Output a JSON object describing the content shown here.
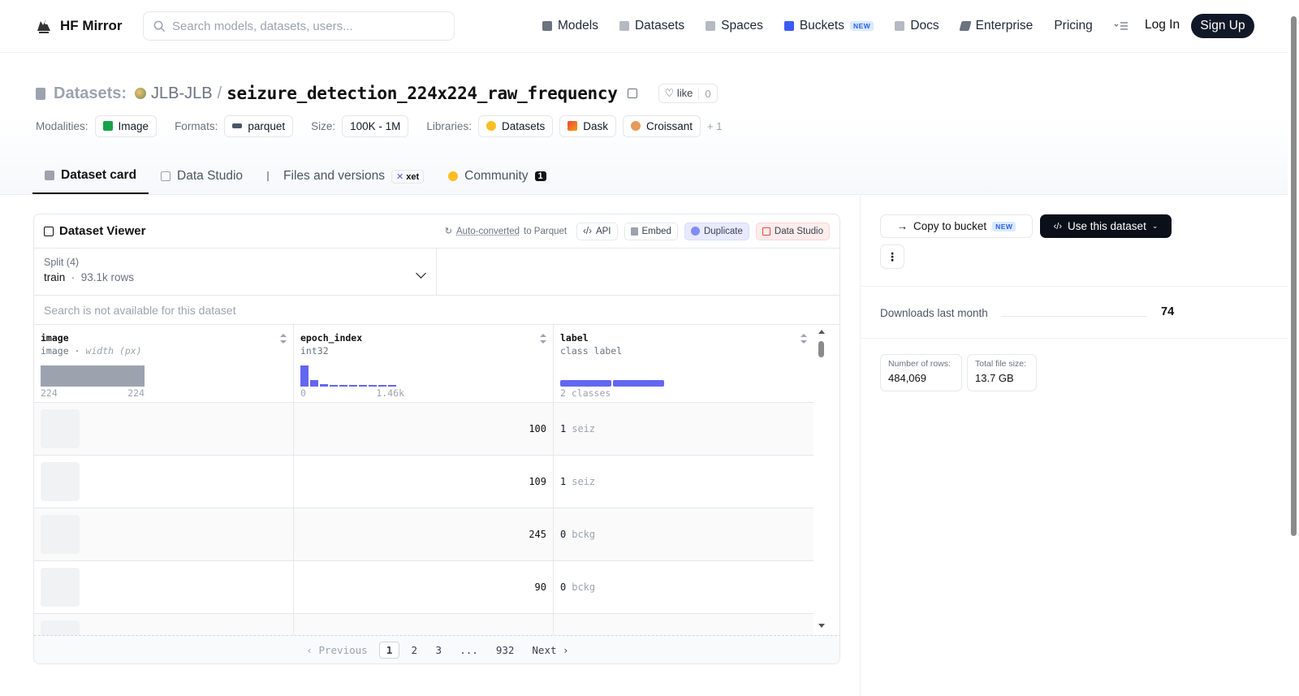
{
  "nav": {
    "logo_text": "HF Mirror",
    "search_placeholder": "Search models, datasets, users...",
    "links": [
      {
        "label": "Models",
        "icon": "cube-icon",
        "color": "#6b7280"
      },
      {
        "label": "Datasets",
        "icon": "database-icon",
        "color": "#9ca3af"
      },
      {
        "label": "Spaces",
        "icon": "grid-icon",
        "color": "#9ca3af"
      },
      {
        "label": "Buckets",
        "icon": "bucket-icon",
        "color": "#3b5bf6",
        "badge": "NEW"
      },
      {
        "label": "Docs",
        "icon": "book-icon",
        "color": "#9ca3af"
      },
      {
        "label": "Enterprise",
        "icon": "lightning-icon",
        "color": "#6b7280"
      },
      {
        "label": "Pricing"
      }
    ],
    "login": "Log In",
    "signup": "Sign Up"
  },
  "header": {
    "prefix": "Datasets:",
    "owner": "JLB-JLB",
    "separator": "/",
    "repo": "seizure_detection_224x224_raw_frequency",
    "like_label": "like",
    "like_count": "0",
    "meta": {
      "modalities_label": "Modalities:",
      "modality": "Image",
      "formats_label": "Formats:",
      "format": "parquet",
      "size_label": "Size:",
      "size": "100K - 1M",
      "libraries_label": "Libraries:",
      "libraries": [
        "Datasets",
        "Dask",
        "Croissant"
      ],
      "more": "+ 1"
    },
    "tabs": [
      {
        "label": "Dataset card",
        "active": true
      },
      {
        "label": "Data Studio"
      },
      {
        "label": "Files and versions",
        "badge": "xet"
      },
      {
        "label": "Community",
        "count": "1"
      }
    ]
  },
  "viewer": {
    "title": "Dataset Viewer",
    "auto_converted": "Auto-converted",
    "to_parquet": "to Parquet",
    "buttons": [
      "API",
      "Embed",
      "Duplicate",
      "Data Studio"
    ],
    "split_label": "Split (4)",
    "split_value": "train",
    "split_rows": "93.1k rows",
    "search_text": "Search is not available for this dataset",
    "columns": [
      {
        "name": "image",
        "type": "image",
        "type_extra": "width (px)",
        "axis_min": "224",
        "axis_max": "224"
      },
      {
        "name": "epoch_index",
        "type": "int32",
        "axis_min": "0",
        "axis_max": "1.46k",
        "hist": [
          1.0,
          0.3,
          0.12,
          0.06,
          0.06,
          0.06,
          0.06,
          0.06,
          0.06,
          0.06
        ]
      },
      {
        "name": "label",
        "type": "class label",
        "axis_min": "2 classes"
      }
    ],
    "rows": [
      {
        "epoch_index": "100",
        "label": "1",
        "label_name": "seiz"
      },
      {
        "epoch_index": "109",
        "label": "1",
        "label_name": "seiz"
      },
      {
        "epoch_index": "245",
        "label": "0",
        "label_name": "bckg"
      },
      {
        "epoch_index": "90",
        "label": "0",
        "label_name": "bckg"
      },
      {
        "epoch_index": "",
        "label": "",
        "label_name": ""
      }
    ],
    "pager": {
      "prev": "Previous",
      "pages": [
        "1",
        "2",
        "3",
        "...",
        "932"
      ],
      "next": "Next"
    }
  },
  "sidebar": {
    "copy_bucket": "Copy to bucket",
    "copy_badge": "NEW",
    "use_dataset": "Use this dataset",
    "more": "⋮",
    "downloads_label": "Downloads last month",
    "downloads_value": "74",
    "rows_label": "Number of rows:",
    "rows_value": "484,069",
    "filesize_label": "Total file size:",
    "filesize_value": "13.7 GB"
  }
}
